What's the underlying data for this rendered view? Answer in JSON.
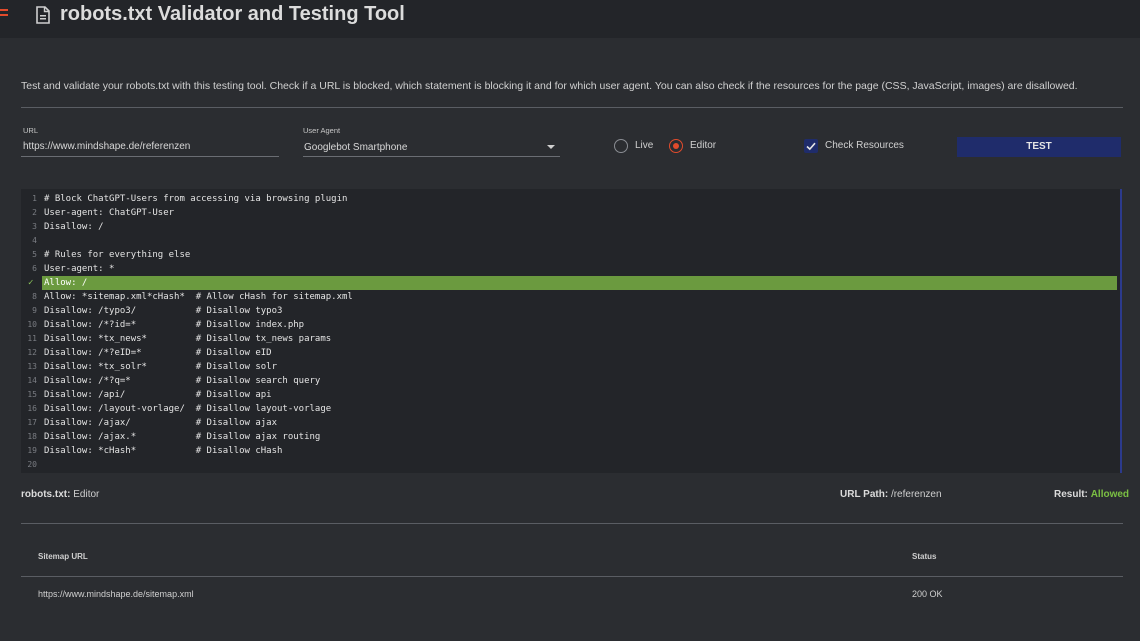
{
  "header": {
    "title": "robots.txt Validator and Testing Tool"
  },
  "description": "Test and validate your robots.txt with this testing tool. Check if a URL is blocked, which statement is blocking it and for which user agent. You can also check if the resources for the page (CSS, JavaScript, images) are disallowed.",
  "form": {
    "url_label": "URL",
    "url_value": "https://www.mindshape.de/referenzen",
    "user_agent_label": "User Agent",
    "user_agent_value": "Googlebot Smartphone",
    "mode_options": [
      {
        "label": "Live",
        "selected": false
      },
      {
        "label": "Editor",
        "selected": true
      }
    ],
    "check_resources_label": "Check Resources",
    "check_resources_checked": true,
    "test_button": "TEST"
  },
  "editor": {
    "highlighted_line": 7,
    "lines": [
      "# Block ChatGPT-Users from accessing via browsing plugin",
      "User-agent: ChatGPT-User",
      "Disallow: /",
      "",
      "# Rules for everything else",
      "User-agent: *",
      "Allow: /",
      "Allow: *sitemap.xml*cHash*  # Allow cHash for sitemap.xml",
      "Disallow: /typo3/           # Disallow typo3",
      "Disallow: /*?id=*           # Disallow index.php",
      "Disallow: *tx_news*         # Disallow tx_news params",
      "Disallow: /*?eID=*          # Disallow eID",
      "Disallow: *tx_solr*         # Disallow solr",
      "Disallow: /*?q=*            # Disallow search query",
      "Disallow: /api/             # Disallow api",
      "Disallow: /layout-vorlage/  # Disallow layout-vorlage",
      "Disallow: /ajax/            # Disallow ajax",
      "Disallow: /ajax.*           # Disallow ajax routing",
      "Disallow: *cHash*           # Disallow cHash",
      ""
    ]
  },
  "result": {
    "robots_label": "robots.txt:",
    "robots_value": "Editor",
    "path_label": "URL Path:",
    "path_value": "/referenzen",
    "result_label": "Result:",
    "result_value": "Allowed"
  },
  "sitemaps": {
    "columns": [
      "Sitemap URL",
      "Status"
    ],
    "rows": [
      {
        "url": "https://www.mindshape.de/sitemap.xml",
        "status": "200 OK"
      }
    ]
  },
  "colors": {
    "accent": "#e14b2c",
    "primary_button": "#1f2c6b",
    "allowed": "#7bc043",
    "highlight": "#6b9a3f"
  }
}
